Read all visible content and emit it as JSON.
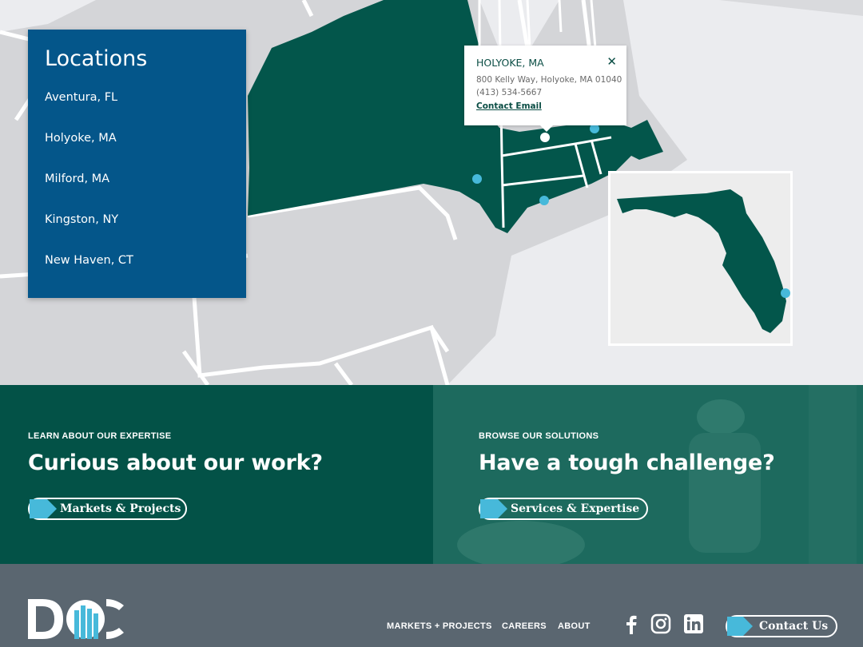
{
  "locations": {
    "title": "Locations",
    "items": [
      "Aventura, FL",
      "Holyoke, MA",
      "Milford, MA",
      "Kingston, NY",
      "New Haven, CT"
    ]
  },
  "popup": {
    "title": "HOLYOKE, MA",
    "close": "✕",
    "address": "800 Kelly Way, Holyoke, MA 01040",
    "phone": "(413) 534-5667",
    "email_label": "Contact Email"
  },
  "cta": {
    "left": {
      "eyebrow": "LEARN ABOUT OUR EXPERTISE",
      "heading": "Curious about our work?",
      "button": "Markets & Projects"
    },
    "right": {
      "eyebrow": "BROWSE OUR SOLUTIONS",
      "heading": "Have a tough challenge?",
      "button": "Services & Expertise"
    }
  },
  "footer": {
    "nav": [
      "MARKETS + PROJECTS",
      "CAREERS",
      "ABOUT"
    ],
    "social": [
      "facebook-icon",
      "instagram-icon",
      "linkedin-icon"
    ],
    "contact": "Contact Us"
  },
  "colors": {
    "map_highlight": "#03564b",
    "panel_blue": "#04568a",
    "marker": "#47b9da",
    "cta_green": "#035247",
    "footer_gray": "#5a6670"
  }
}
